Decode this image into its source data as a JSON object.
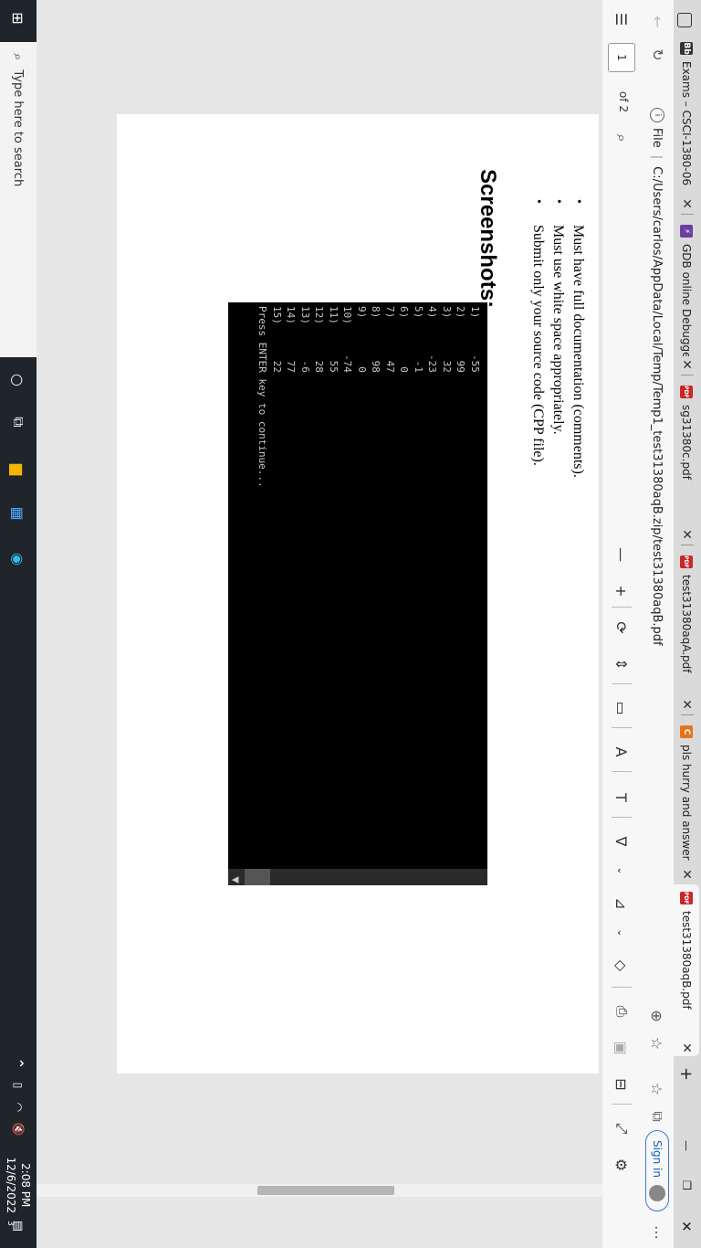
{
  "tabs": [
    {
      "title": "Exams – CSCI-1380-06",
      "icon": "blackboard-icon",
      "color": "#333333",
      "glyph": "Bb"
    },
    {
      "title": "GDB online Debugger",
      "icon": "gdb-icon",
      "color": "#6b3fa0",
      "glyph": "⚡"
    },
    {
      "title": "sg31380c.pdf",
      "icon": "pdf-icon",
      "color": "#c62828",
      "glyph": "PDF"
    },
    {
      "title": "test31380aqA.pdf",
      "icon": "pdf-icon",
      "color": "#c62828",
      "glyph": "PDF"
    },
    {
      "title": "pls hurry and answer",
      "icon": "chegg-icon",
      "color": "#e8731a",
      "glyph": "C"
    },
    {
      "title": "test31380aqB.pdf",
      "icon": "pdf-icon",
      "color": "#c62828",
      "glyph": "PDF"
    }
  ],
  "address": {
    "file_label": "File",
    "url": "C:/Users/carlos/AppData/Local/Temp/Temp1_test31380aqB.zip/test31380aqB.pdf",
    "sign_in": "Sign in"
  },
  "pdf_toolbar": {
    "page_number": "1",
    "page_of": "of 2"
  },
  "document": {
    "bullets": [
      "Must have full documentation (comments).",
      "Must use white space appropriately.",
      "Submit only your source code (CPP file)."
    ],
    "heading": "Screenshots:",
    "console_lines": [
      "1)      -55",
      "2)       99",
      "3)       32",
      "4)      -23",
      "5)       -1",
      "6)        0",
      "7)       47",
      "8)       98",
      "9)        0",
      "10)     -74",
      "11)      55",
      "12)      28",
      "13)      -6",
      "14)      77",
      "15)      22",
      "",
      "Press ENTER key to continue..."
    ]
  },
  "taskbar": {
    "search_placeholder": "Type here to search",
    "time": "2:08 PM",
    "date": "12/6/2022",
    "notification_count": "3"
  }
}
